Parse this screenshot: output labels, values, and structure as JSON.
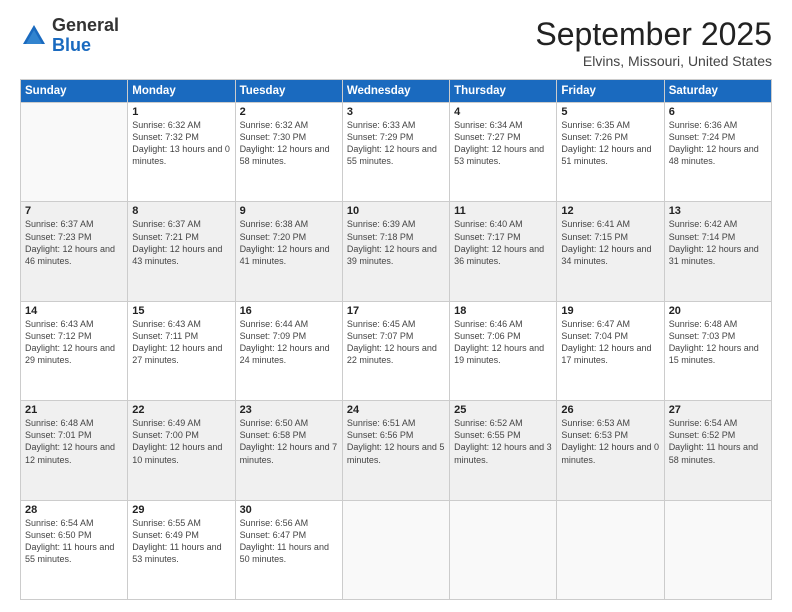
{
  "logo": {
    "general": "General",
    "blue": "Blue"
  },
  "header": {
    "month": "September 2025",
    "location": "Elvins, Missouri, United States"
  },
  "weekdays": [
    "Sunday",
    "Monday",
    "Tuesday",
    "Wednesday",
    "Thursday",
    "Friday",
    "Saturday"
  ],
  "weeks": [
    [
      {
        "day": "",
        "empty": true
      },
      {
        "day": "1",
        "sunrise": "Sunrise: 6:32 AM",
        "sunset": "Sunset: 7:32 PM",
        "daylight": "Daylight: 13 hours and 0 minutes."
      },
      {
        "day": "2",
        "sunrise": "Sunrise: 6:32 AM",
        "sunset": "Sunset: 7:30 PM",
        "daylight": "Daylight: 12 hours and 58 minutes."
      },
      {
        "day": "3",
        "sunrise": "Sunrise: 6:33 AM",
        "sunset": "Sunset: 7:29 PM",
        "daylight": "Daylight: 12 hours and 55 minutes."
      },
      {
        "day": "4",
        "sunrise": "Sunrise: 6:34 AM",
        "sunset": "Sunset: 7:27 PM",
        "daylight": "Daylight: 12 hours and 53 minutes."
      },
      {
        "day": "5",
        "sunrise": "Sunrise: 6:35 AM",
        "sunset": "Sunset: 7:26 PM",
        "daylight": "Daylight: 12 hours and 51 minutes."
      },
      {
        "day": "6",
        "sunrise": "Sunrise: 6:36 AM",
        "sunset": "Sunset: 7:24 PM",
        "daylight": "Daylight: 12 hours and 48 minutes."
      }
    ],
    [
      {
        "day": "7",
        "sunrise": "Sunrise: 6:37 AM",
        "sunset": "Sunset: 7:23 PM",
        "daylight": "Daylight: 12 hours and 46 minutes."
      },
      {
        "day": "8",
        "sunrise": "Sunrise: 6:37 AM",
        "sunset": "Sunset: 7:21 PM",
        "daylight": "Daylight: 12 hours and 43 minutes."
      },
      {
        "day": "9",
        "sunrise": "Sunrise: 6:38 AM",
        "sunset": "Sunset: 7:20 PM",
        "daylight": "Daylight: 12 hours and 41 minutes."
      },
      {
        "day": "10",
        "sunrise": "Sunrise: 6:39 AM",
        "sunset": "Sunset: 7:18 PM",
        "daylight": "Daylight: 12 hours and 39 minutes."
      },
      {
        "day": "11",
        "sunrise": "Sunrise: 6:40 AM",
        "sunset": "Sunset: 7:17 PM",
        "daylight": "Daylight: 12 hours and 36 minutes."
      },
      {
        "day": "12",
        "sunrise": "Sunrise: 6:41 AM",
        "sunset": "Sunset: 7:15 PM",
        "daylight": "Daylight: 12 hours and 34 minutes."
      },
      {
        "day": "13",
        "sunrise": "Sunrise: 6:42 AM",
        "sunset": "Sunset: 7:14 PM",
        "daylight": "Daylight: 12 hours and 31 minutes."
      }
    ],
    [
      {
        "day": "14",
        "sunrise": "Sunrise: 6:43 AM",
        "sunset": "Sunset: 7:12 PM",
        "daylight": "Daylight: 12 hours and 29 minutes."
      },
      {
        "day": "15",
        "sunrise": "Sunrise: 6:43 AM",
        "sunset": "Sunset: 7:11 PM",
        "daylight": "Daylight: 12 hours and 27 minutes."
      },
      {
        "day": "16",
        "sunrise": "Sunrise: 6:44 AM",
        "sunset": "Sunset: 7:09 PM",
        "daylight": "Daylight: 12 hours and 24 minutes."
      },
      {
        "day": "17",
        "sunrise": "Sunrise: 6:45 AM",
        "sunset": "Sunset: 7:07 PM",
        "daylight": "Daylight: 12 hours and 22 minutes."
      },
      {
        "day": "18",
        "sunrise": "Sunrise: 6:46 AM",
        "sunset": "Sunset: 7:06 PM",
        "daylight": "Daylight: 12 hours and 19 minutes."
      },
      {
        "day": "19",
        "sunrise": "Sunrise: 6:47 AM",
        "sunset": "Sunset: 7:04 PM",
        "daylight": "Daylight: 12 hours and 17 minutes."
      },
      {
        "day": "20",
        "sunrise": "Sunrise: 6:48 AM",
        "sunset": "Sunset: 7:03 PM",
        "daylight": "Daylight: 12 hours and 15 minutes."
      }
    ],
    [
      {
        "day": "21",
        "sunrise": "Sunrise: 6:48 AM",
        "sunset": "Sunset: 7:01 PM",
        "daylight": "Daylight: 12 hours and 12 minutes."
      },
      {
        "day": "22",
        "sunrise": "Sunrise: 6:49 AM",
        "sunset": "Sunset: 7:00 PM",
        "daylight": "Daylight: 12 hours and 10 minutes."
      },
      {
        "day": "23",
        "sunrise": "Sunrise: 6:50 AM",
        "sunset": "Sunset: 6:58 PM",
        "daylight": "Daylight: 12 hours and 7 minutes."
      },
      {
        "day": "24",
        "sunrise": "Sunrise: 6:51 AM",
        "sunset": "Sunset: 6:56 PM",
        "daylight": "Daylight: 12 hours and 5 minutes."
      },
      {
        "day": "25",
        "sunrise": "Sunrise: 6:52 AM",
        "sunset": "Sunset: 6:55 PM",
        "daylight": "Daylight: 12 hours and 3 minutes."
      },
      {
        "day": "26",
        "sunrise": "Sunrise: 6:53 AM",
        "sunset": "Sunset: 6:53 PM",
        "daylight": "Daylight: 12 hours and 0 minutes."
      },
      {
        "day": "27",
        "sunrise": "Sunrise: 6:54 AM",
        "sunset": "Sunset: 6:52 PM",
        "daylight": "Daylight: 11 hours and 58 minutes."
      }
    ],
    [
      {
        "day": "28",
        "sunrise": "Sunrise: 6:54 AM",
        "sunset": "Sunset: 6:50 PM",
        "daylight": "Daylight: 11 hours and 55 minutes."
      },
      {
        "day": "29",
        "sunrise": "Sunrise: 6:55 AM",
        "sunset": "Sunset: 6:49 PM",
        "daylight": "Daylight: 11 hours and 53 minutes."
      },
      {
        "day": "30",
        "sunrise": "Sunrise: 6:56 AM",
        "sunset": "Sunset: 6:47 PM",
        "daylight": "Daylight: 11 hours and 50 minutes."
      },
      {
        "day": "",
        "empty": true
      },
      {
        "day": "",
        "empty": true
      },
      {
        "day": "",
        "empty": true
      },
      {
        "day": "",
        "empty": true
      }
    ]
  ]
}
